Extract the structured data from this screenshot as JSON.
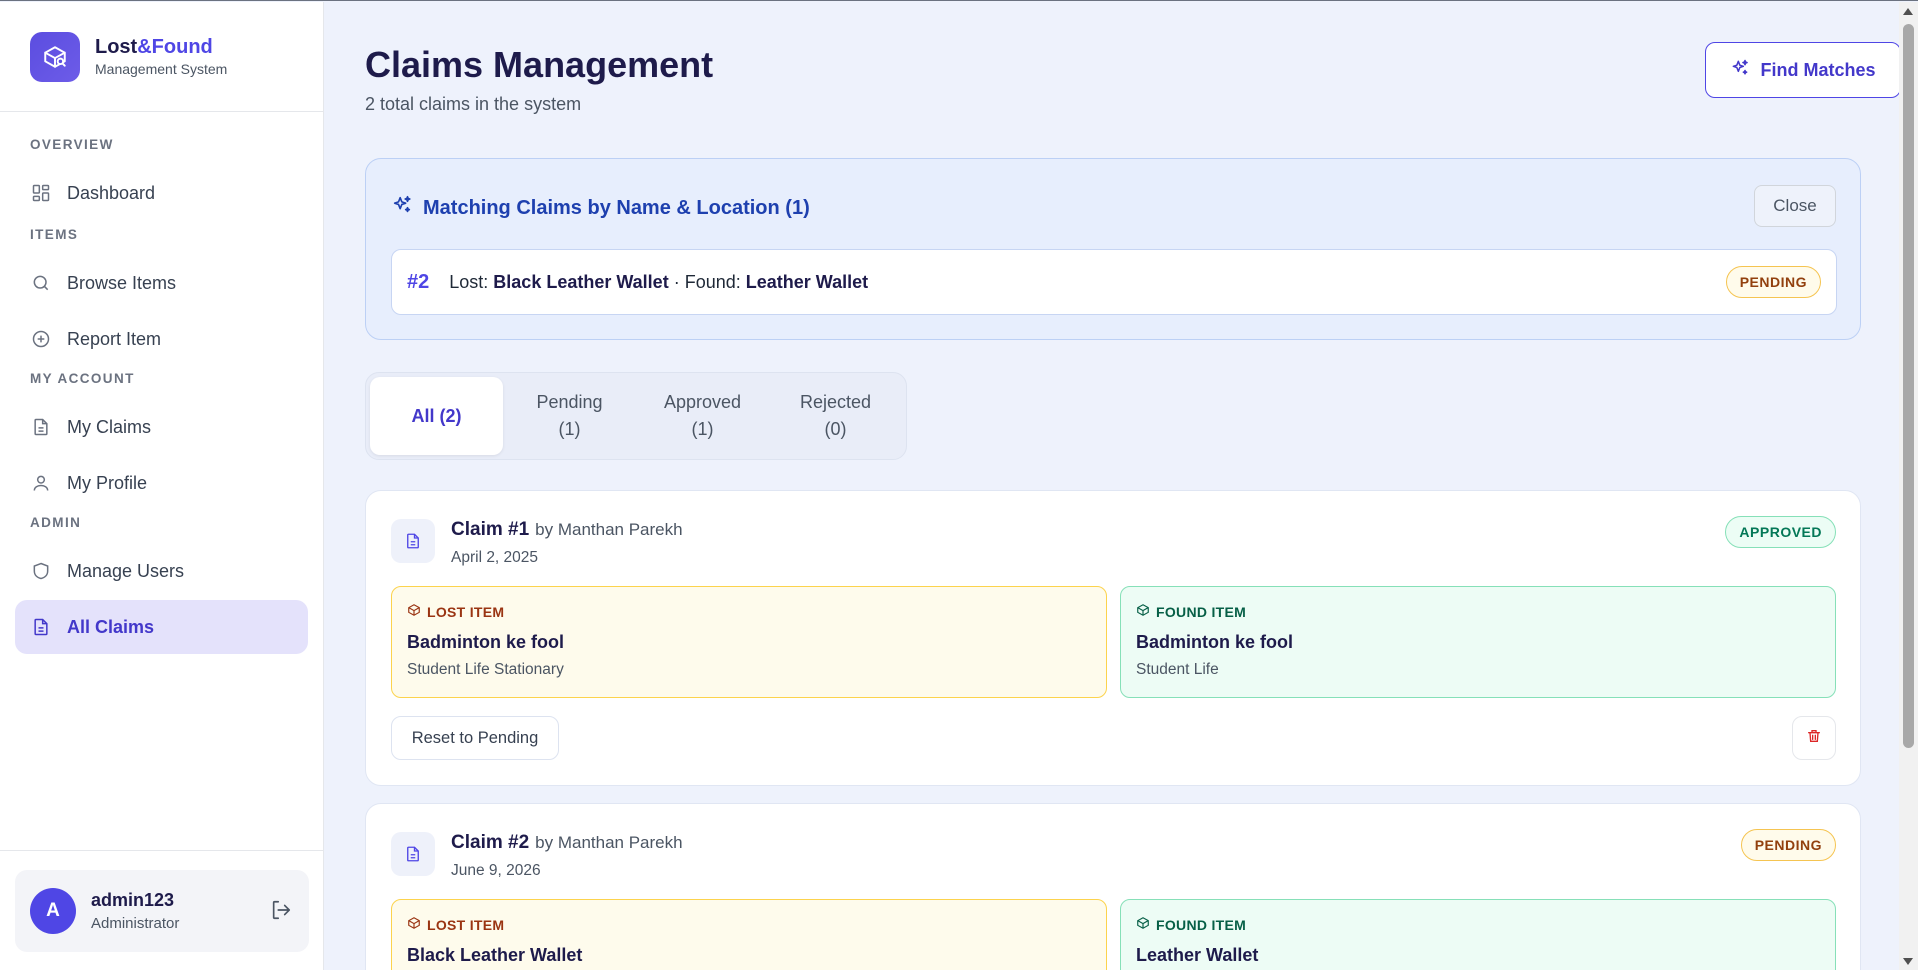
{
  "brand": {
    "name_part1": "Lost",
    "name_part2": "&Found",
    "subtitle": "Management System"
  },
  "sidebar": {
    "sections": [
      "OVERVIEW",
      "ITEMS",
      "MY ACCOUNT",
      "ADMIN"
    ],
    "items": [
      {
        "label": "Dashboard",
        "icon": "grid-icon"
      },
      {
        "label": "Browse Items",
        "icon": "search-icon"
      },
      {
        "label": "Report Item",
        "icon": "plus-circle-icon"
      },
      {
        "label": "My Claims",
        "icon": "document-icon"
      },
      {
        "label": "My Profile",
        "icon": "user-icon"
      },
      {
        "label": "Manage Users",
        "icon": "shield-icon"
      },
      {
        "label": "All Claims",
        "icon": "document-icon",
        "active": true
      }
    ]
  },
  "user": {
    "avatar_letter": "A",
    "name": "admin123",
    "role": "Administrator"
  },
  "header": {
    "title": "Claims Management",
    "subtitle": "2 total claims in the system",
    "find_button": "Find Matches"
  },
  "matches": {
    "title": "Matching Claims by Name & Location (1)",
    "close_label": "Close",
    "rows": [
      {
        "id": "#2",
        "lost_prefix": "Lost:",
        "lost_item": "Black Leather Wallet",
        "separator": "· Found:",
        "found_item": "Leather Wallet",
        "status": "PENDING"
      }
    ]
  },
  "tabs": [
    {
      "label": "All (2)",
      "active": true
    },
    {
      "label_line1": "Pending",
      "label_line2": "(1)"
    },
    {
      "label_line1": "Approved",
      "label_line2": "(1)"
    },
    {
      "label_line1": "Rejected",
      "label_line2": "(0)"
    }
  ],
  "claims": [
    {
      "title": "Claim #1",
      "by": "by Manthan Parekh",
      "date": "April 2, 2025",
      "status": "APPROVED",
      "lost": {
        "kind": "LOST ITEM",
        "name": "Badminton ke fool",
        "location": "Student Life Stationary"
      },
      "found": {
        "kind": "FOUND ITEM",
        "name": "Badminton ke fool",
        "location": "Student Life"
      },
      "reset_label": "Reset to Pending"
    },
    {
      "title": "Claim #2",
      "by": "by Manthan Parekh",
      "date": "June 9, 2026",
      "status": "PENDING",
      "lost": {
        "kind": "LOST ITEM",
        "name": "Black Leather Wallet"
      },
      "found": {
        "kind": "FOUND ITEM",
        "name": "Leather Wallet"
      }
    }
  ],
  "colors": {
    "accent": "#4f46e5",
    "approved": "#047857",
    "pending": "#92400e",
    "delete": "#dc2626"
  }
}
